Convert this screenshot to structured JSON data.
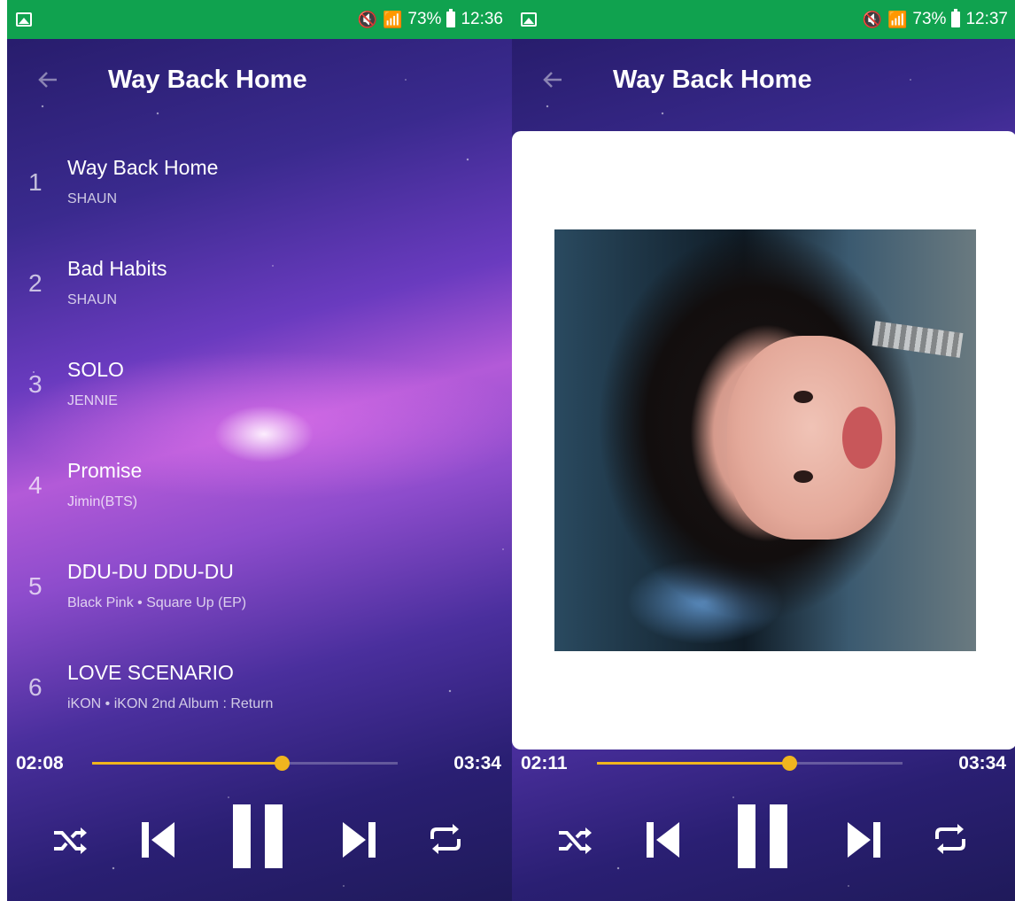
{
  "status_bars": [
    {
      "battery": "73%",
      "time": "12:36"
    },
    {
      "battery": "73%",
      "time": "12:37"
    }
  ],
  "header": {
    "title": "Way Back Home"
  },
  "playlist": [
    {
      "number": "1",
      "title": "Way Back Home",
      "artist": "SHAUN"
    },
    {
      "number": "2",
      "title": "Bad Habits",
      "artist": "SHAUN"
    },
    {
      "number": "3",
      "title": "SOLO",
      "artist": "JENNIE"
    },
    {
      "number": "4",
      "title": "Promise",
      "artist": "Jimin(BTS)"
    },
    {
      "number": "5",
      "title": "DDU-DU DDU-DU",
      "artist": "Black Pink • Square Up (EP)"
    },
    {
      "number": "6",
      "title": "LOVE SCENARIO",
      "artist": "iKON • iKON 2nd Album : Return"
    }
  ],
  "player_left": {
    "elapsed": "02:08",
    "total": "03:34",
    "progress": 0.62
  },
  "player_right": {
    "elapsed": "02:11",
    "total": "03:34",
    "progress": 0.63
  },
  "colors": {
    "status_bar": "#10a24f",
    "accent": "#f0b51e",
    "text": "#ffffff"
  },
  "icons": {
    "status": [
      "gallery-icon",
      "mute-icon",
      "wifi-icon",
      "signal-icon",
      "battery-icon"
    ],
    "controls": [
      "shuffle-icon",
      "previous-icon",
      "pause-icon",
      "next-icon",
      "repeat-icon"
    ],
    "header": "back-arrow-icon"
  }
}
